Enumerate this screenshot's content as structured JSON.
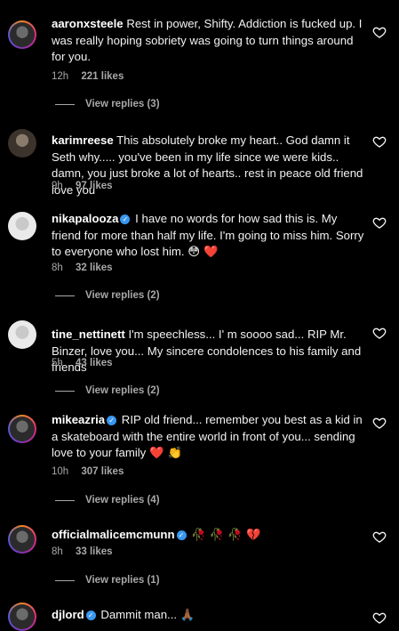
{
  "comments": [
    {
      "username": "aaronxsteele",
      "verified": false,
      "text": "Rest in power, Shifty. Addiction is fucked up. I was really hoping sobriety was going to turn things around for you.",
      "time": "12h",
      "likes": "221 likes",
      "replies": "View replies (3)"
    },
    {
      "username": "karimreese",
      "verified": false,
      "text": "This absolutely broke my heart.. God damn it Seth why..... you've been in my life since we were kids.. damn, you just broke a lot of hearts.. rest in peace old friend love you",
      "time": "9h",
      "likes": "97 likes",
      "replies": ""
    },
    {
      "username": "nikapalooza",
      "verified": true,
      "text": "I have no words for how sad this is. My friend for more than half my life. I'm going to miss him. Sorry to everyone who lost him.",
      "emoji": "😳 ❤️",
      "time": "8h",
      "likes": "32 likes",
      "replies": "View replies (2)"
    },
    {
      "username": "tine_nettinett",
      "verified": false,
      "text": "I'm speechless... I' m soooo sad... RIP Mr. Binzer, love you... My sincere condolences to his family and friends",
      "time": "5h",
      "likes": "43 likes",
      "replies": "View replies (2)"
    },
    {
      "username": "mikeazria",
      "verified": true,
      "text": "RIP old friend... remember you best as a kid in a skateboard with the entire world in front of you... sending love to your family",
      "emoji": "❤️ 👏",
      "time": "10h",
      "likes": "307 likes",
      "replies": "View replies (4)"
    },
    {
      "username": "officialmalicemcmunn",
      "verified": true,
      "text": "",
      "emoji": "🥀 🥀 🥀 💔",
      "time": "8h",
      "likes": "33 likes",
      "replies": "View replies (1)"
    },
    {
      "username": "djlord",
      "verified": true,
      "text": "Dammit man...",
      "emoji": "🙏🏾",
      "time": "",
      "likes": "",
      "replies": ""
    }
  ],
  "icons": {
    "like": "heart-outline-icon",
    "verified": "verified-badge-icon"
  },
  "colors": {
    "background": "#000000",
    "meta_text": "#a8a8a8",
    "verified": "#3897f0"
  }
}
